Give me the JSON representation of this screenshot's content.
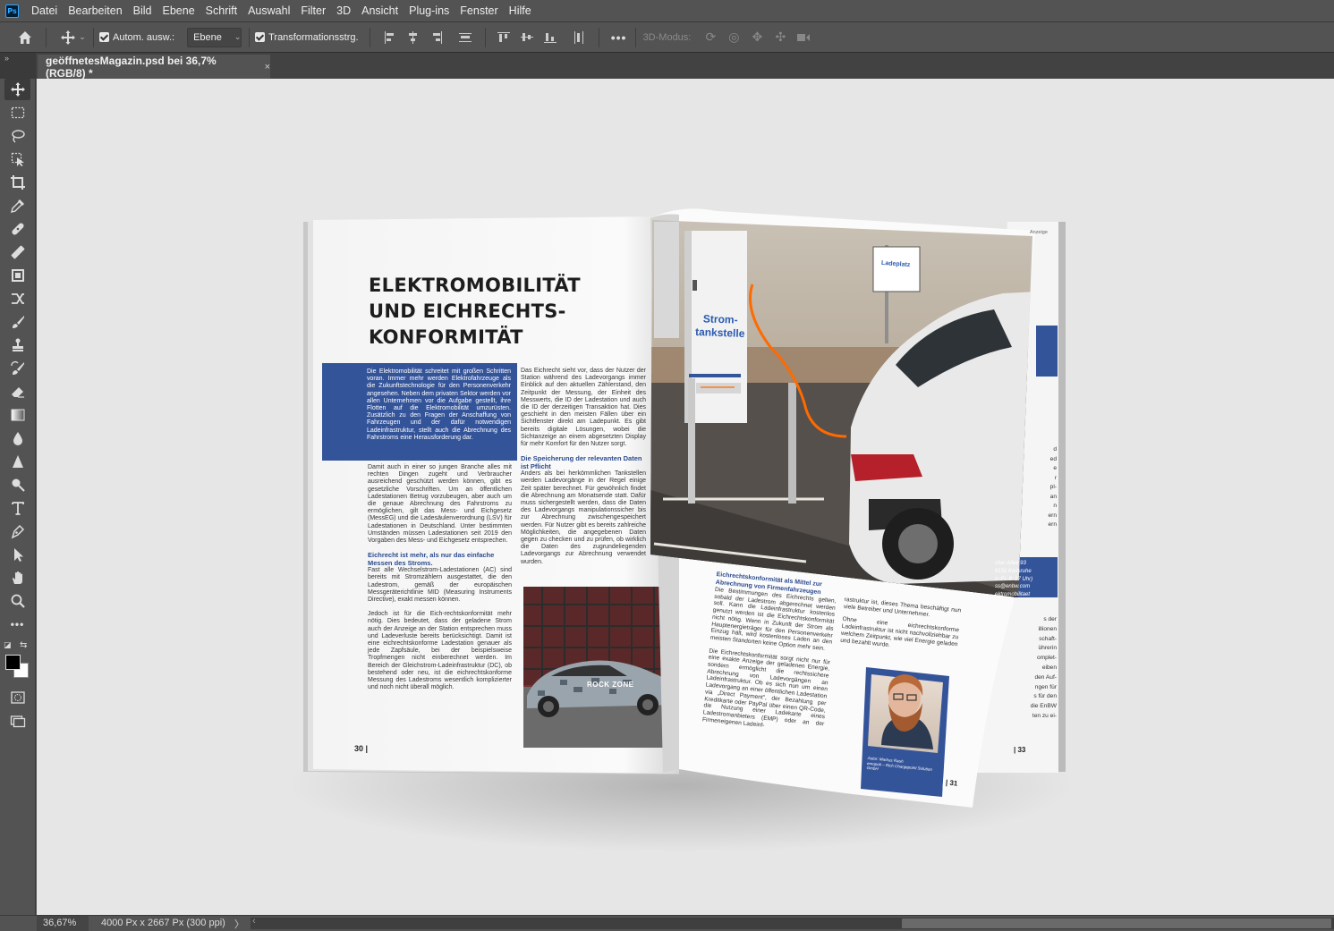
{
  "menubar": {
    "logo": "Ps",
    "items": [
      "Datei",
      "Bearbeiten",
      "Bild",
      "Ebene",
      "Schrift",
      "Auswahl",
      "Filter",
      "3D",
      "Ansicht",
      "Plug-ins",
      "Fenster",
      "Hilfe"
    ]
  },
  "options": {
    "auto_select_label": "Autom. ausw.:",
    "auto_select_value": "Ebene",
    "transform_label": "Transformationsstrg.",
    "mode_3d_label": "3D-Modus:"
  },
  "document": {
    "tab_title": "geöffnetesMagazin.psd bei 36,7% (RGB/8) *",
    "close_symbol": "×"
  },
  "status": {
    "zoom": "36,67%",
    "info": "4000 Px x 2667 Px (300 ppi)",
    "arrow": "〉",
    "scroll_arrow": "‹"
  },
  "colors": {
    "foreground": "#000000",
    "background": "#ffffff",
    "accent_blue": "#34549a"
  },
  "tools": [
    "move-tool",
    "marquee-tool",
    "lasso-tool",
    "object-select-tool",
    "crop-tool",
    "eyedropper-tool",
    "healing-brush-tool",
    "frame-tool",
    "patch-tool",
    "brush-tool",
    "clone-stamp-tool",
    "history-brush-tool",
    "eraser-tool",
    "gradient-tool",
    "blur-tool",
    "dodge-tool",
    "sharpen-tool",
    "text-tool",
    "pen-tool",
    "path-select-tool",
    "hand-tool",
    "zoom-tool",
    "more-tools"
  ],
  "magazine": {
    "headline": [
      "ELEKTROMOBILITÄT",
      "UND EICHRECHTS-",
      "KONFORMITÄT"
    ],
    "intro": "Die Elektromobilität schreitet mit großen Schritten voran. Immer mehr werden Elektrofahrzeuge als die Zukunftstechnologie für den Personenverkehr angesehen. Neben dem privaten Sektor werden vor allen Unternehmen vor die Aufgabe gestellt, ihre Flotten auf die Elektromobilität umzurüsten. Zusätzlich zu den Fragen der Anschaffung von Fahrzeugen und der dafür notwendigen Ladeinfrastruktur, stellt auch die Abrechnung des Fahrstroms eine Herausforderung dar.",
    "col1_p1": "Damit auch in einer so jungen Branche alles mit rechten Dingen zugeht und Verbraucher ausreichend geschützt werden können, gibt es gesetzliche Vorschriften. Um an öffentlichen Ladestationen Betrug vorzubeugen, aber auch um die genaue Abrechnung des Fahrstroms zu ermöglichen, gilt das Mess- und Eichgesetz (MessEG) und die Ladesäulenverordnung (LSV) für Ladestationen in Deutschland. Unter bestimmten Umständen müssen Ladestationen seit 2019 den Vorgaben des Mess- und Eichgesetz entsprechen.",
    "col1_sub": "Eichrecht ist mehr, als nur das einfache Messen des Stroms.",
    "col1_p2": "Fast alle Wechselstrom-Ladestationen (AC) sind bereits mit Stromzählern ausgestattet, die den Ladestrom, gemäß der europäischen Messgeräterichtlinie MID (Measuring Instruments Directive), exakt messen können.",
    "col1_p3": "Jedoch ist für die Eich-rechtskonformität mehr nötig. Dies bedeutet, dass der geladene Strom auch der Anzeige an der Station entsprechen muss und Ladeverluste bereits berücksichtigt. Damit ist eine eichrechtskonforme Ladestation genauer als jede Zapfsäule, bei der beispielsweise Tropfmengen nicht einberechnet werden. Im Bereich der Gleichstrom-Ladeinfrastruktur (DC), ob bestehend oder neu, ist die eichrechtskonforme Messung des Ladestroms wesentlich komplizierter und noch nicht überall möglich.",
    "col2_p1": "Das Eichrecht sieht vor, dass der Nutzer der Station während des Ladevorgangs immer Einblick auf den aktuellen Zählerstand, den Zeitpunkt der Messung, der Einheit des Messwerts, die ID der Ladestation und auch die ID der derzeitigen Transaktion hat. Dies geschieht in den meisten Fällen über ein Sichtfenster direkt am Ladepunkt. Es gibt bereits digitale Lösungen, wobei die Sichtanzeige an einem abgesetzten Display für mehr Komfort für den Nutzer sorgt.",
    "col2_sub": "Die Speicherung der relevanten Daten ist Pflicht",
    "col2_p2": "Anders als bei herkömmlichen Tankstellen werden Ladevorgänge in der Regel einige Zeit später berechnet. Für gewöhnlich findet die Abrechnung am Monatsende statt. Dafür muss sichergestellt werden, dass die Daten des Ladevorgangs manipulationssicher bis zur Abrechnung zwischengespeichert werden. Für Nutzer gibt es bereits zahlreiche Möglichkeiten, die angegebenen Daten gegen zu checken und zu prüfen, ob wirklich die Daten des zugrundeliegenden Ladevorgangs zur Abrechnung verwendet wurden.",
    "page_left": "30 |",
    "page_right_back": "| 33",
    "page_right_front": "| 31",
    "anzeige": "Anzeige",
    "station_label": [
      "Strom-",
      "tankstelle"
    ],
    "sign_label": "Ladeplatz",
    "car_brand": "ROCK ZONE",
    "right_sub": "Eichrechtskonformität als Mittel zur Abrechnung von Firmenfahrzeugen",
    "right_p1": "Die Bestimmungen des Eichrechts gelten, sobald der Ladestrom abgerechnet werden soll. Kann die Ladeinfrastruktur kostenlos genutzt werden ist die Eichrechtskonformität nicht nötig. Wenn in Zukunft der Strom als Hauptenergieträger für den Personenverkehr Einzug hält, wird kostenloses Laden an den meisten Standorten keine Option mehr sein.",
    "right_p2": "Die Eichrechtskonformität sorgt nicht nur für eine exakte Anzeige der geladenen Energie, sondern ermöglicht die rechtssichere Abrechnung von Ladevorgängen an Ladeinfrastruktur. Ob es sich nun um einen Ladevorgang an einer öffentlichen Ladestation via „Direct Payment\", der Bezahlung per Kreditkarte oder PayPal über einen QR-Code, die Nutzung einer Ladekarte eines Ladestromanbieters (EMP) oder an der Firmeneigenen Ladeinf-",
    "right_p3": "rastruktur ist, dieses Thema beschäftigt nun viele Betreiber und Unternehmer.",
    "right_p4": "Ohne eine eichrechtskonforme Ladeinfrastruktur ist nicht nachvollziehbar zu welchem Zeitpunkt, wie viel Energie geladen und bezahlt wurde.",
    "author_caption": [
      "Autor: Markus Rauh",
      "emopoli – Rich Chargepoint Solution",
      "GmbH"
    ],
    "back_contact": [
      "cher Allee 93",
      "6131 Karlsruhe",
      "o–Fr. 8–17 Uhr)",
      "ss@enbw.com",
      "ektromobilitaet"
    ],
    "back_fragments": [
      "d",
      "ed",
      "e",
      "r",
      "pl-",
      "an",
      "n",
      "ern",
      "ern",
      "s der",
      "illionen",
      "schaft-",
      "ührerin",
      "omplet-",
      "eiben",
      "den Auf-",
      "ngen für",
      "s für den",
      "die EnBW",
      "ten zu ei-"
    ]
  }
}
